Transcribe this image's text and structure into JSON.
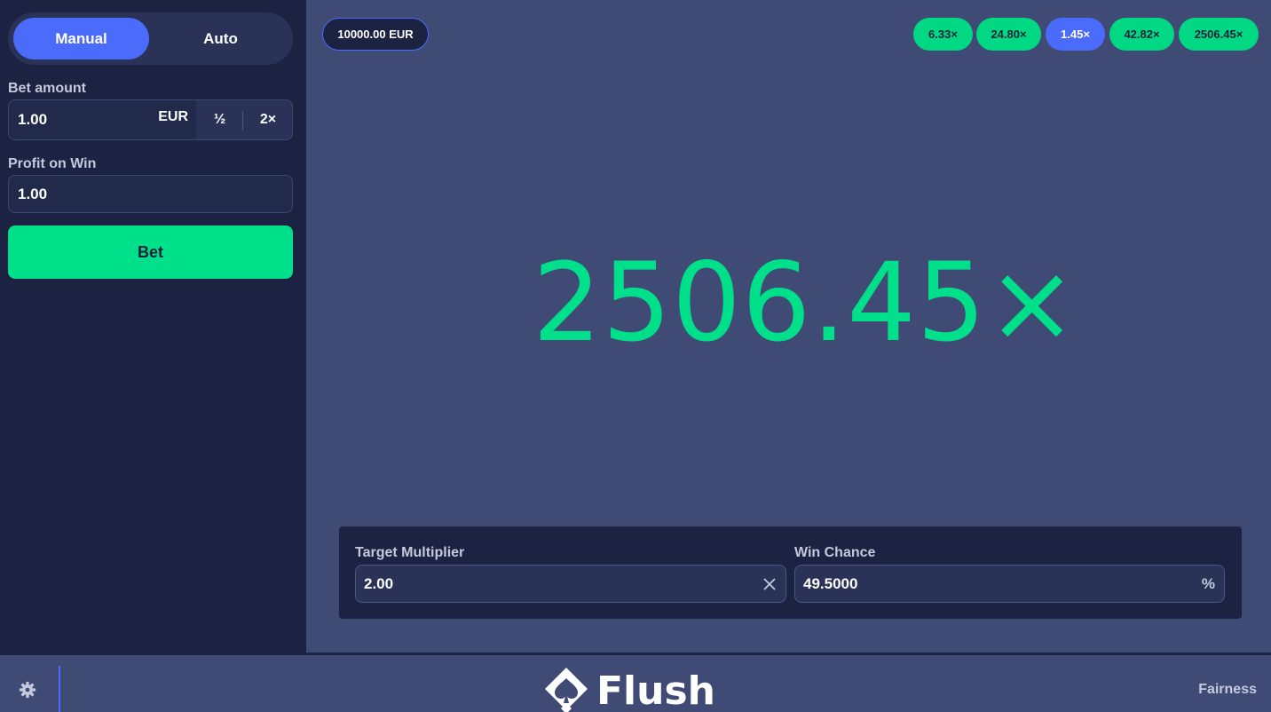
{
  "sidebar": {
    "modes": {
      "manual": "Manual",
      "auto": "Auto",
      "active": "Manual"
    },
    "bet_amount": {
      "label": "Bet amount",
      "value": "1.00",
      "currency": "EUR",
      "half_label": "½",
      "double_label": "2×"
    },
    "profit_on_win": {
      "label": "Profit on Win",
      "value": "1.00"
    },
    "bet_button_label": "Bet"
  },
  "header": {
    "balance": "10000.00 EUR",
    "history": [
      {
        "label": "6.33×",
        "status": "win"
      },
      {
        "label": "24.80×",
        "status": "win"
      },
      {
        "label": "1.45×",
        "status": "lose"
      },
      {
        "label": "42.82×",
        "status": "win"
      },
      {
        "label": "2506.45×",
        "status": "win"
      }
    ]
  },
  "result": {
    "multiplier": "2506.45×"
  },
  "controls": {
    "target_multiplier": {
      "label": "Target Multiplier",
      "value": "2.00",
      "clear_icon": "close-icon"
    },
    "win_chance": {
      "label": "Win Chance",
      "value": "49.5000",
      "suffix": "%"
    }
  },
  "footer": {
    "settings_icon": "gear-icon",
    "logo_text": "Flush",
    "fairness_label": "Fairness"
  },
  "colors": {
    "accent_blue": "#4b6bfb",
    "win_green": "#00e08a",
    "sidebar_bg": "#1c2342",
    "main_bg": "#3f4a75"
  }
}
